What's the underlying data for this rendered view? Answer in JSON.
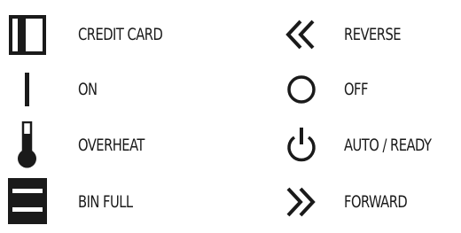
{
  "legend": {
    "items": [
      {
        "icon": "credit-card-icon",
        "label": "CREDIT CARD"
      },
      {
        "icon": "on-icon",
        "label": "ON"
      },
      {
        "icon": "overheat-icon",
        "label": "OVERHEAT"
      },
      {
        "icon": "bin-full-icon",
        "label": "BIN FULL"
      },
      {
        "icon": "reverse-icon",
        "label": "REVERSE"
      },
      {
        "icon": "off-icon",
        "label": "OFF"
      },
      {
        "icon": "auto-ready-icon",
        "label": "AUTO / READY"
      },
      {
        "icon": "forward-icon",
        "label": "FORWARD"
      }
    ]
  }
}
